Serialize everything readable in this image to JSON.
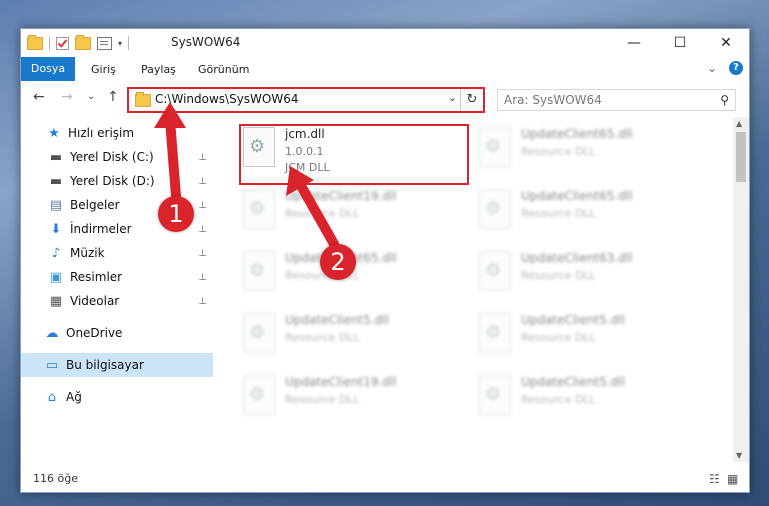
{
  "window": {
    "title": "SysWOW64",
    "min_glyph": "—",
    "max_glyph": "☐",
    "close_glyph": "✕"
  },
  "ribbon": {
    "tabs": [
      "Dosya",
      "Giriş",
      "Paylaş",
      "Görünüm"
    ],
    "collapse_glyph": "⌄",
    "help_glyph": "?"
  },
  "address": {
    "path": "C:\\Windows\\SysWOW64",
    "search_placeholder": "Ara: SysWOW64",
    "back_glyph": "←",
    "forward_glyph": "→",
    "recent_glyph": "⌄",
    "up_glyph": "↑",
    "dropdown_glyph": "⌄",
    "refresh_glyph": "↻",
    "search_glyph": "⚲"
  },
  "sidebar": {
    "items": [
      {
        "label": "Hızlı erişim",
        "icon": "star-icon",
        "glyph": "★",
        "color": "#2a7fd4",
        "pinned": false
      },
      {
        "label": "Yerel Disk (C:)",
        "icon": "drive-icon",
        "glyph": "▬",
        "color": "#555555",
        "pinned": true
      },
      {
        "label": "Yerel Disk (D:)",
        "icon": "drive-icon",
        "glyph": "▬",
        "color": "#555555",
        "pinned": true
      },
      {
        "label": "Belgeler",
        "icon": "documents-icon",
        "glyph": "▤",
        "color": "#5a7fa8",
        "pinned": true
      },
      {
        "label": "İndirmeler",
        "icon": "download-icon",
        "glyph": "⬇",
        "color": "#2a7fd4",
        "pinned": true
      },
      {
        "label": "Müzik",
        "icon": "music-icon",
        "glyph": "♪",
        "color": "#2a7fd4",
        "pinned": true
      },
      {
        "label": "Resimler",
        "icon": "pictures-icon",
        "glyph": "▣",
        "color": "#3a9ad9",
        "pinned": true
      },
      {
        "label": "Videolar",
        "icon": "videos-icon",
        "glyph": "▦",
        "color": "#555555",
        "pinned": true
      },
      {
        "label": "OneDrive",
        "icon": "cloud-icon",
        "glyph": "☁",
        "color": "#2a7fd4",
        "pinned": false
      },
      {
        "label": "Bu bilgisayar",
        "icon": "computer-icon",
        "glyph": "▭",
        "color": "#2a7fd4",
        "pinned": false
      },
      {
        "label": "Ağ",
        "icon": "network-icon",
        "glyph": "⌂",
        "color": "#2a7fd4",
        "pinned": false
      }
    ],
    "pin_glyph": "📌"
  },
  "files": [
    {
      "name": "jcm.dll",
      "version": "1.0.0.1",
      "desc": "JCM DLL",
      "blurred": false
    },
    {
      "name": "UpdateClient65.dll",
      "version": "",
      "desc": "Resource DLL",
      "blurred": true
    },
    {
      "name": "UpdateClient19.dll",
      "version": "",
      "desc": "Resource DLL",
      "blurred": true
    },
    {
      "name": "UpdateClient65.dll",
      "version": "",
      "desc": "Resource DLL",
      "blurred": true
    },
    {
      "name": "UpdateClient65.dll",
      "version": "",
      "desc": "Resource DLL",
      "blurred": true
    },
    {
      "name": "UpdateClient63.dll",
      "version": "",
      "desc": "Resource DLL",
      "blurred": true
    },
    {
      "name": "UpdateClient5.dll",
      "version": "",
      "desc": "Resource DLL",
      "blurred": true
    },
    {
      "name": "UpdateClient5.dll",
      "version": "",
      "desc": "Resource DLL",
      "blurred": true
    },
    {
      "name": "UpdateClient19.dll",
      "version": "",
      "desc": "Resource DLL",
      "blurred": true
    },
    {
      "name": "UpdateClient5.dll",
      "version": "",
      "desc": "Resource DLL",
      "blurred": true
    }
  ],
  "status": {
    "count": "116 öğe"
  },
  "annotations": {
    "badge1": "1",
    "badge2": "2",
    "color": "#d9242b"
  }
}
